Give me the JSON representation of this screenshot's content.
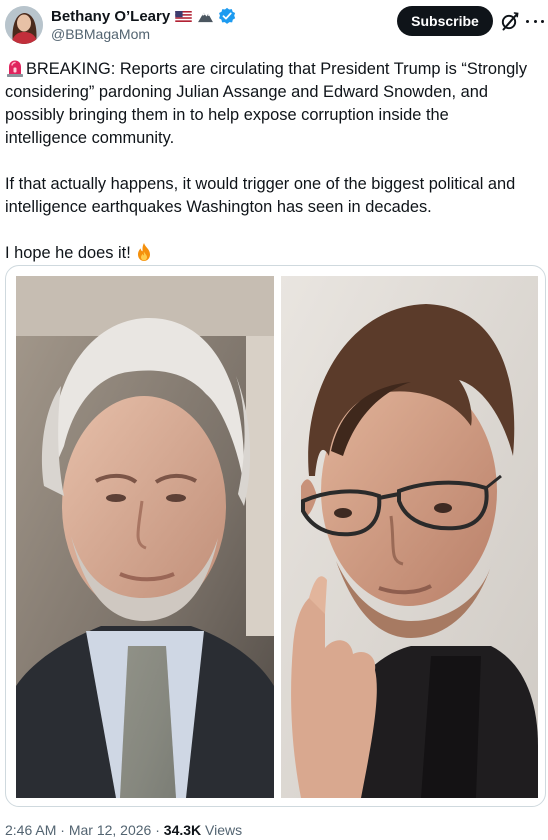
{
  "author": {
    "display_name": "Bethany O’Leary",
    "handle": "@BBMagaMom",
    "badges": [
      "us-flag-icon",
      "mountain-icon",
      "verified-badge-icon"
    ],
    "verified_color": "#1d9bf0"
  },
  "actions": {
    "subscribe_label": "Subscribe",
    "grok_icon": "grok-icon",
    "more_icon": "more-options-icon"
  },
  "tweet": {
    "paragraph1": [
      "BREAKING: Reports are circulating that President Trump is “Strongly",
      "considering” pardoning Julian Assange and Edward Snowden, and",
      "possibly bringing them in to help expose corruption inside the",
      "intelligence community."
    ],
    "paragraph2": [
      "If that actually happens, it would trigger one of the biggest political and",
      "intelligence earthquakes Washington has seen in decades."
    ],
    "paragraph3": "I hope he does it!",
    "lead_emoji": "siren-emoji",
    "trail_emoji": "fire-emoji"
  },
  "media": {
    "images": [
      "photo-left-man-grey-hair-suit",
      "photo-right-man-glasses"
    ]
  },
  "meta": {
    "time": "2:46 AM",
    "separator": "·",
    "date": "Mar 12, 2026",
    "views_count": "34.3K",
    "views_label": "Views"
  },
  "colors": {
    "text": "#0f1419",
    "muted": "#536471",
    "border": "#cfd9de",
    "button_bg": "#0f1419"
  }
}
